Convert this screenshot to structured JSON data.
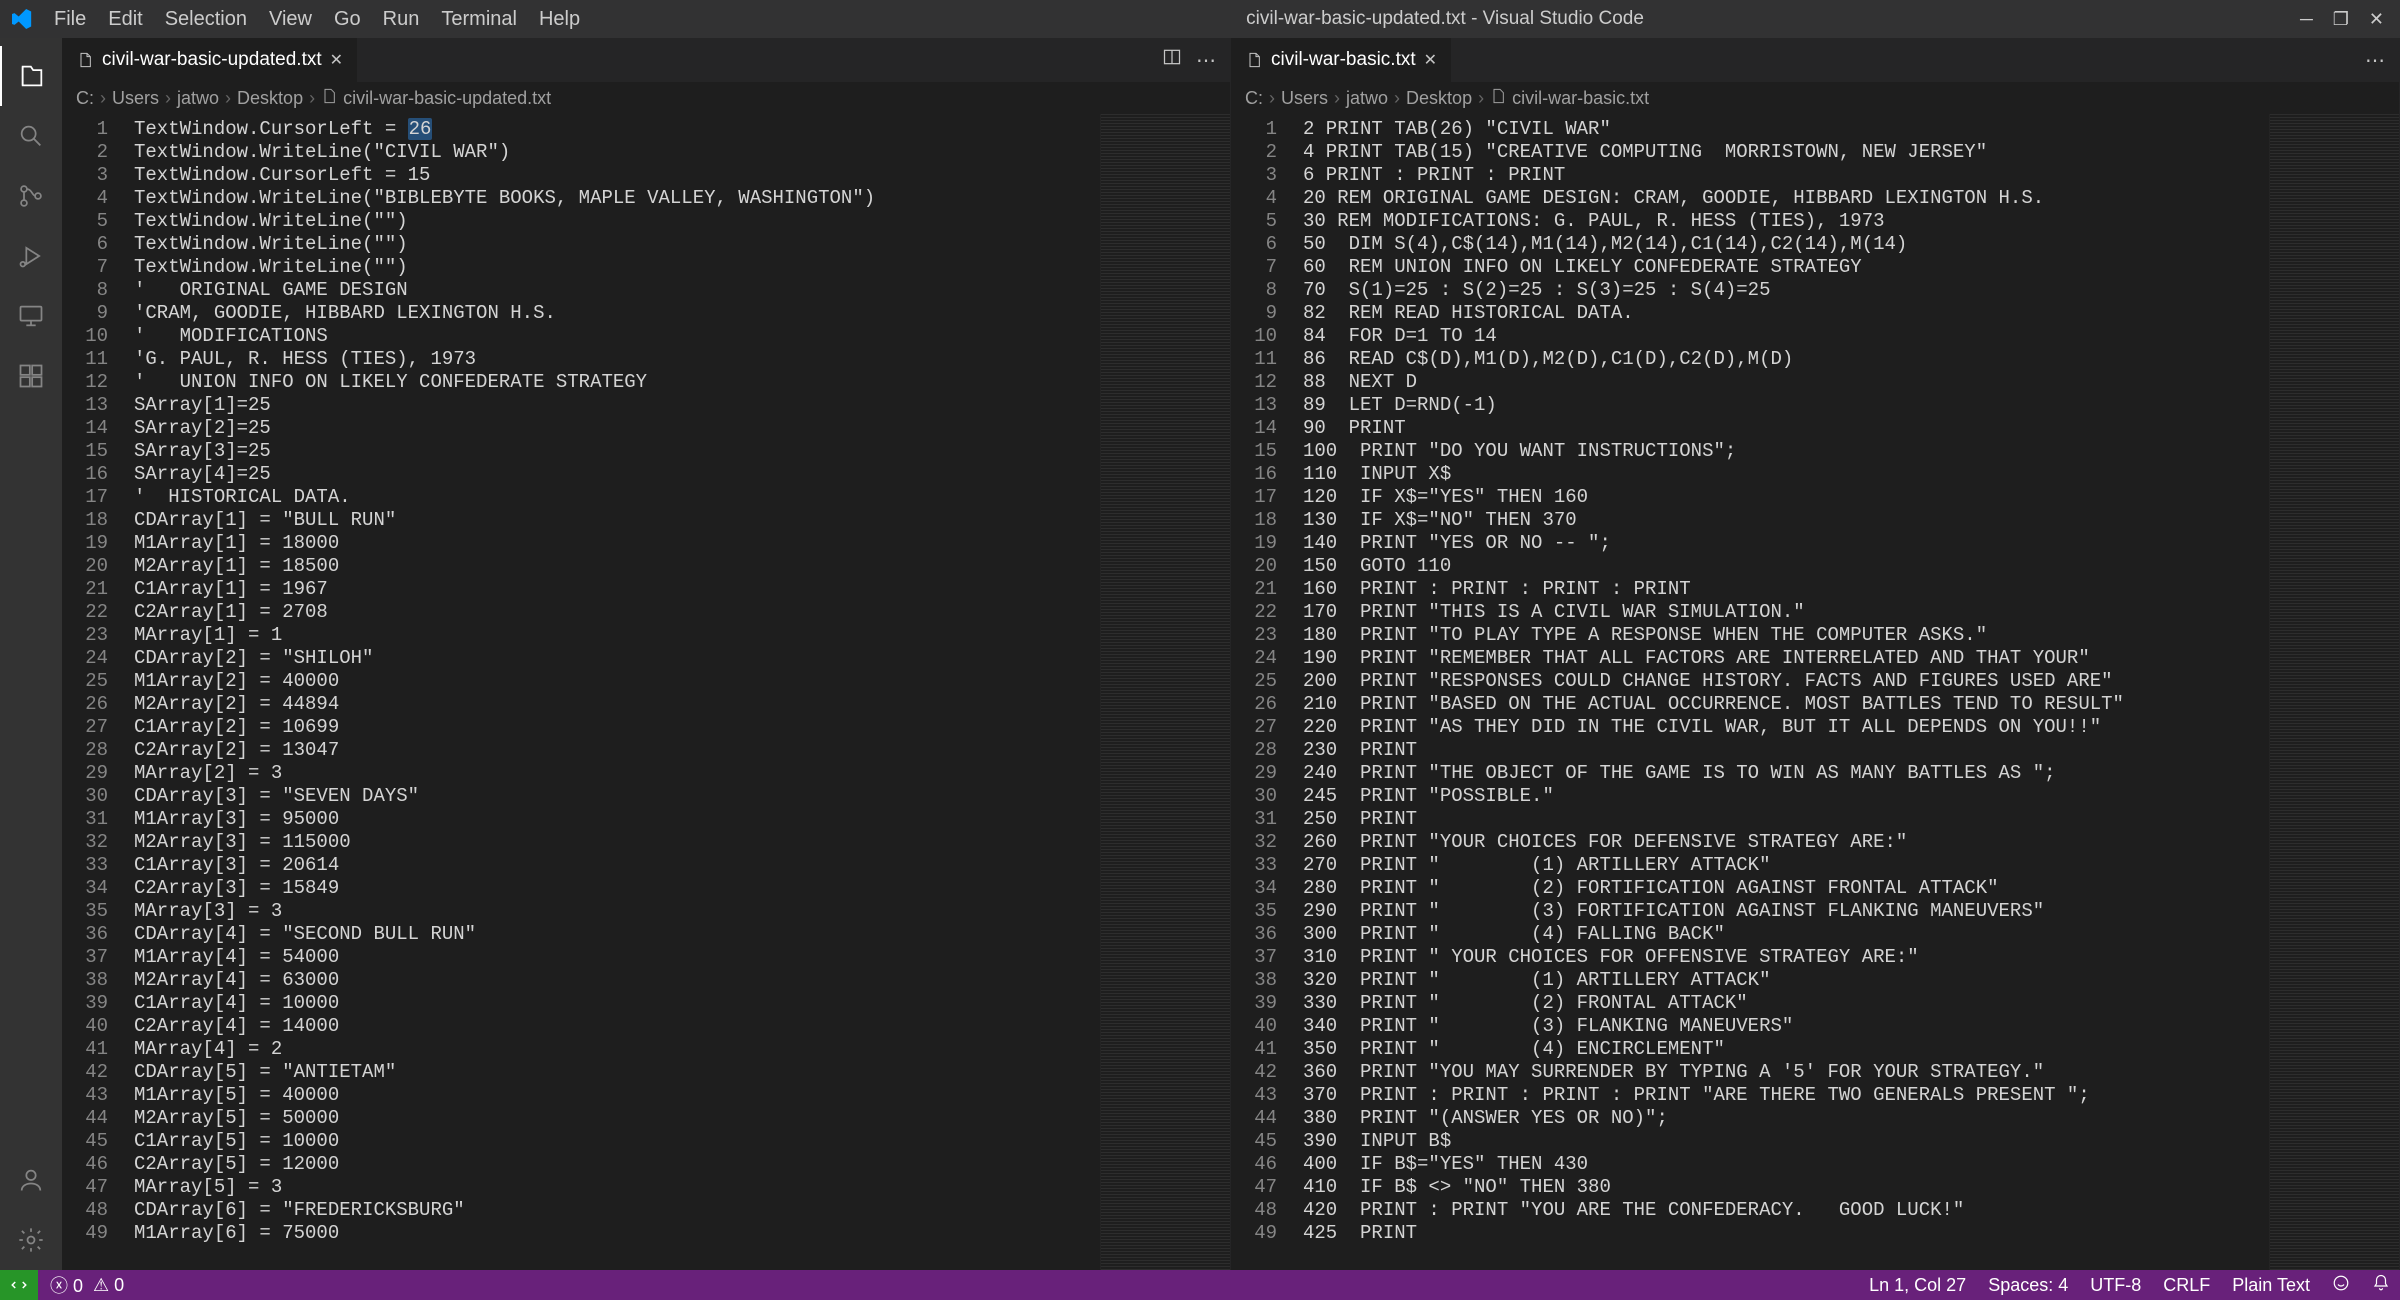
{
  "title": "civil-war-basic-updated.txt - Visual Studio Code",
  "menubar": [
    "File",
    "Edit",
    "Selection",
    "View",
    "Go",
    "Run",
    "Terminal",
    "Help"
  ],
  "tab1": {
    "name": "civil-war-basic-updated.txt"
  },
  "tab2": {
    "name": "civil-war-basic.txt"
  },
  "breadcrumb1": [
    "C:",
    "Users",
    "jatwo",
    "Desktop",
    "civil-war-basic-updated.txt"
  ],
  "breadcrumb2": [
    "C:",
    "Users",
    "jatwo",
    "Desktop",
    "civil-war-basic.txt"
  ],
  "left": {
    "lines": [
      "TextWindow.CursorLeft = 26",
      "TextWindow.WriteLine(\"CIVIL WAR\")",
      "TextWindow.CursorLeft = 15",
      "TextWindow.WriteLine(\"BIBLEBYTE BOOKS, MAPLE VALLEY, WASHINGTON\")",
      "TextWindow.WriteLine(\"\")",
      "TextWindow.WriteLine(\"\")",
      "TextWindow.WriteLine(\"\")",
      "'   ORIGINAL GAME DESIGN",
      "'CRAM, GOODIE, HIBBARD LEXINGTON H.S.",
      "'   MODIFICATIONS",
      "'G. PAUL, R. HESS (TIES), 1973",
      "'   UNION INFO ON LIKELY CONFEDERATE STRATEGY",
      "SArray[1]=25",
      "SArray[2]=25",
      "SArray[3]=25",
      "SArray[4]=25",
      "'  HISTORICAL DATA.",
      "CDArray[1] = \"BULL RUN\"",
      "M1Array[1] = 18000",
      "M2Array[1] = 18500",
      "C1Array[1] = 1967",
      "C2Array[1] = 2708",
      "MArray[1] = 1",
      "CDArray[2] = \"SHILOH\"",
      "M1Array[2] = 40000",
      "M2Array[2] = 44894",
      "C1Array[2] = 10699",
      "C2Array[2] = 13047",
      "MArray[2] = 3",
      "CDArray[3] = \"SEVEN DAYS\"",
      "M1Array[3] = 95000",
      "M2Array[3] = 115000",
      "C1Array[3] = 20614",
      "C2Array[3] = 15849",
      "MArray[3] = 3",
      "CDArray[4] = \"SECOND BULL RUN\"",
      "M1Array[4] = 54000",
      "M2Array[4] = 63000",
      "C1Array[4] = 10000",
      "C2Array[4] = 14000",
      "MArray[4] = 2",
      "CDArray[5] = \"ANTIETAM\"",
      "M1Array[5] = 40000",
      "M2Array[5] = 50000",
      "C1Array[5] = 10000",
      "C2Array[5] = 12000",
      "MArray[5] = 3",
      "CDArray[6] = \"FREDERICKSBURG\"",
      "M1Array[6] = 75000"
    ]
  },
  "right": {
    "lines": [
      "2 PRINT TAB(26) \"CIVIL WAR\"",
      "4 PRINT TAB(15) \"CREATIVE COMPUTING  MORRISTOWN, NEW JERSEY\"",
      "6 PRINT : PRINT : PRINT",
      "20 REM ORIGINAL GAME DESIGN: CRAM, GOODIE, HIBBARD LEXINGTON H.S.",
      "30 REM MODIFICATIONS: G. PAUL, R. HESS (TIES), 1973",
      "50  DIM S(4),C$(14),M1(14),M2(14),C1(14),C2(14),M(14)",
      "60  REM UNION INFO ON LIKELY CONFEDERATE STRATEGY",
      "70  S(1)=25 : S(2)=25 : S(3)=25 : S(4)=25",
      "82  REM READ HISTORICAL DATA.",
      "84  FOR D=1 TO 14",
      "86  READ C$(D),M1(D),M2(D),C1(D),C2(D),M(D)",
      "88  NEXT D",
      "89  LET D=RND(-1)",
      "90  PRINT",
      "100  PRINT \"DO YOU WANT INSTRUCTIONS\";",
      "110  INPUT X$",
      "120  IF X$=\"YES\" THEN 160",
      "130  IF X$=\"NO\" THEN 370",
      "140  PRINT \"YES OR NO -- \";",
      "150  GOTO 110",
      "160  PRINT : PRINT : PRINT : PRINT",
      "170  PRINT \"THIS IS A CIVIL WAR SIMULATION.\"",
      "180  PRINT \"TO PLAY TYPE A RESPONSE WHEN THE COMPUTER ASKS.\"",
      "190  PRINT \"REMEMBER THAT ALL FACTORS ARE INTERRELATED AND THAT YOUR\"",
      "200  PRINT \"RESPONSES COULD CHANGE HISTORY. FACTS AND FIGURES USED ARE\"",
      "210  PRINT \"BASED ON THE ACTUAL OCCURRENCE. MOST BATTLES TEND TO RESULT\"",
      "220  PRINT \"AS THEY DID IN THE CIVIL WAR, BUT IT ALL DEPENDS ON YOU!!\"",
      "230  PRINT",
      "240  PRINT \"THE OBJECT OF THE GAME IS TO WIN AS MANY BATTLES AS \";",
      "245  PRINT \"POSSIBLE.\"",
      "250  PRINT",
      "260  PRINT \"YOUR CHOICES FOR DEFENSIVE STRATEGY ARE:\"",
      "270  PRINT \"        (1) ARTILLERY ATTACK\"",
      "280  PRINT \"        (2) FORTIFICATION AGAINST FRONTAL ATTACK\"",
      "290  PRINT \"        (3) FORTIFICATION AGAINST FLANKING MANEUVERS\"",
      "300  PRINT \"        (4) FALLING BACK\"",
      "310  PRINT \" YOUR CHOICES FOR OFFENSIVE STRATEGY ARE:\"",
      "320  PRINT \"        (1) ARTILLERY ATTACK\"",
      "330  PRINT \"        (2) FRONTAL ATTACK\"",
      "340  PRINT \"        (3) FLANKING MANEUVERS\"",
      "350  PRINT \"        (4) ENCIRCLEMENT\"",
      "360  PRINT \"YOU MAY SURRENDER BY TYPING A '5' FOR YOUR STRATEGY.\"",
      "370  PRINT : PRINT : PRINT : PRINT \"ARE THERE TWO GENERALS PRESENT \";",
      "380  PRINT \"(ANSWER YES OR NO)\";",
      "390  INPUT B$",
      "400  IF B$=\"YES\" THEN 430",
      "410  IF B$ <> \"NO\" THEN 380",
      "420  PRINT : PRINT \"YOU ARE THE CONFEDERACY.   GOOD LUCK!\"",
      "425  PRINT"
    ]
  },
  "status": {
    "errors": "0",
    "warnings": "0",
    "pos": "Ln 1, Col 27",
    "spaces": "Spaces: 4",
    "encoding": "UTF-8",
    "eol": "CRLF",
    "lang": "Plain Text"
  }
}
